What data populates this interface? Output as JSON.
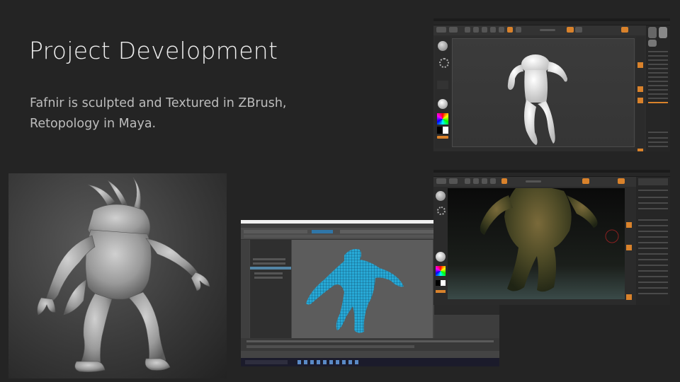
{
  "slide": {
    "title": "Project Development",
    "body_line1": "Fafnir is sculpted and Textured in ZBrush,",
    "body_line2": "Retopology in Maya."
  },
  "images": {
    "zbrush_basemesh": "zbrush-basemesh-screenshot",
    "sculpt_render": "fafnir-grey-sculpt-render",
    "maya_retopo": "maya-retopology-screenshot",
    "zbrush_textured": "zbrush-textured-screenshot"
  },
  "colors": {
    "background": "#242424",
    "zbrush_accent": "#d9822b",
    "maya_mesh": "#27a9d6"
  }
}
